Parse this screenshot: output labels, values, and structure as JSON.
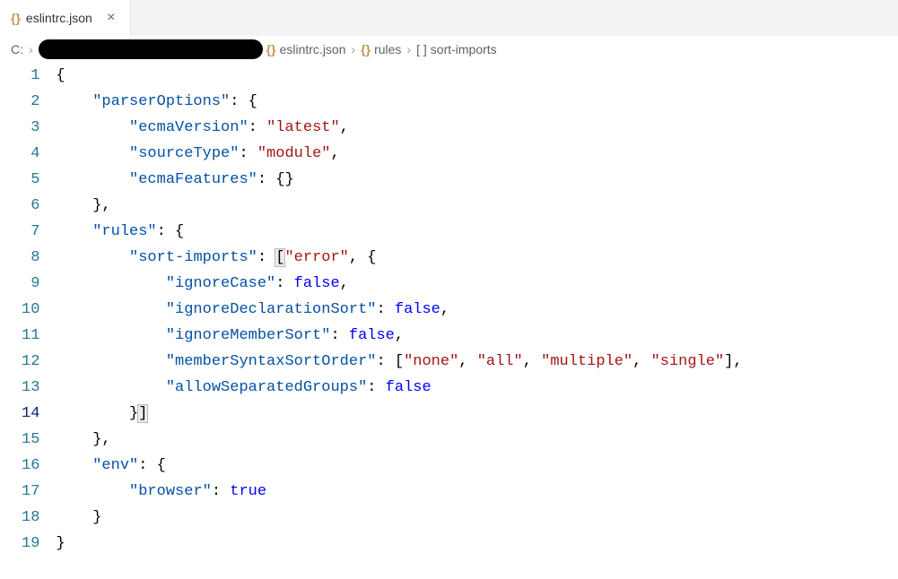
{
  "tab": {
    "icon": "{}",
    "label": "eslintrc.json",
    "close": "×"
  },
  "breadcrumb": {
    "drive": "C:",
    "sep": "›",
    "file_icon": "{}",
    "file": "eslintrc.json",
    "rules_icon": "{}",
    "rules": "rules",
    "arr_icon": "[ ]",
    "sort": "sort-imports"
  },
  "lines": {
    "l1": "1",
    "l2": "2",
    "l3": "3",
    "l4": "4",
    "l5": "5",
    "l6": "6",
    "l7": "7",
    "l8": "8",
    "l9": "9",
    "l10": "10",
    "l11": "11",
    "l12": "12",
    "l13": "13",
    "l14": "14",
    "l15": "15",
    "l16": "16",
    "l17": "17",
    "l18": "18",
    "l19": "19"
  },
  "code": {
    "open_brace": "{",
    "close_brace": "}",
    "open_bracket": "[",
    "close_bracket": "]",
    "comma": ",",
    "colon": ":",
    "parserOptions": "\"parserOptions\"",
    "ecmaVersion": "\"ecmaVersion\"",
    "latest": "\"latest\"",
    "sourceType": "\"sourceType\"",
    "module": "\"module\"",
    "ecmaFeatures": "\"ecmaFeatures\"",
    "rules": "\"rules\"",
    "sortImports": "\"sort-imports\"",
    "error": "\"error\"",
    "ignoreCase": "\"ignoreCase\"",
    "ignoreDeclarationSort": "\"ignoreDeclarationSort\"",
    "ignoreMemberSort": "\"ignoreMemberSort\"",
    "memberSyntaxSortOrder": "\"memberSyntaxSortOrder\"",
    "none": "\"none\"",
    "all": "\"all\"",
    "multiple": "\"multiple\"",
    "single": "\"single\"",
    "allowSeparatedGroups": "\"allowSeparatedGroups\"",
    "env": "\"env\"",
    "browser": "\"browser\"",
    "false": "false",
    "true": "true",
    "empty_obj": "{}"
  }
}
